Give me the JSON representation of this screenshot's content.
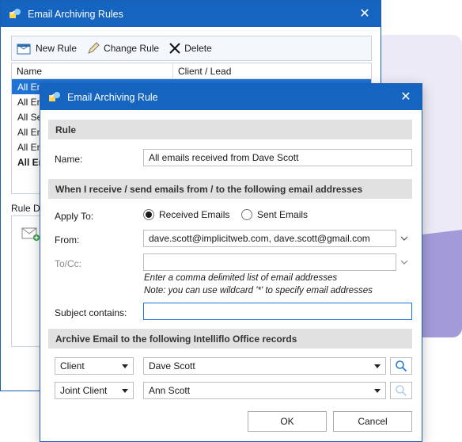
{
  "back_window": {
    "title": "Email Archiving Rules",
    "toolbar": {
      "new_rule": "New Rule",
      "change_rule": "Change Rule",
      "delete": "Delete"
    },
    "columns": [
      "Name",
      "Client / Lead"
    ],
    "rows": [
      "All Em",
      "All Em",
      "All Se",
      "All Em",
      "All Em",
      "All Em"
    ],
    "rule_details_label": "Rule D"
  },
  "dialog": {
    "title": "Email Archiving Rule",
    "rule_section": "Rule",
    "name_label": "Name:",
    "name_value": "All emails received from Dave Scott",
    "emails_section": "When I receive / send emails from / to the following email addresses",
    "apply_to_label": "Apply To:",
    "received_label": "Received Emails",
    "sent_label": "Sent Emails",
    "from_label": "From:",
    "from_value": "dave.scott@implicitweb.com, dave.scott@gmail.com",
    "tocc_label": "To/Cc:",
    "tocc_value": "",
    "hint1": "Enter a comma delimited list of email addresses",
    "hint2": "Note: you can use wildcard '*' to specify email addresses",
    "subject_label": "Subject contains:",
    "subject_value": "",
    "archive_section": "Archive Email to the following Intelliflo Office records",
    "record1_type": "Client",
    "record1_value": "Dave Scott",
    "record2_type": "Joint Client",
    "record2_value": "Ann Scott",
    "ok_label": "OK",
    "cancel_label": "Cancel"
  },
  "colors": {
    "titlebar": "#1565c0",
    "selection": "#1e73d6",
    "section_bg": "#e1e1e1",
    "accent_purple": "#a39bd9"
  }
}
